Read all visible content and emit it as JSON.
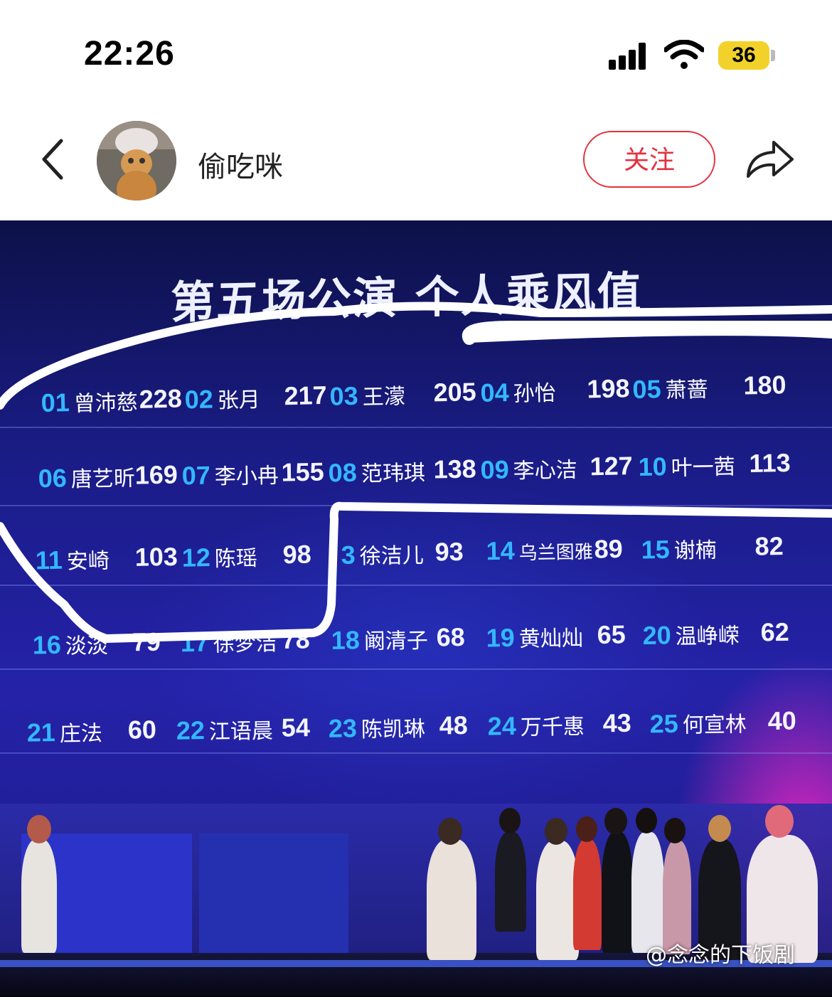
{
  "status_bar": {
    "time": "22:26",
    "battery": "36"
  },
  "header": {
    "username": "偷吃咪",
    "follow_label": "关注"
  },
  "board": {
    "title": "第五场公演 个人乘风值",
    "rows": [
      [
        {
          "num": "01",
          "name": "曾沛慈",
          "value": "228"
        },
        {
          "num": "02",
          "name": "张月",
          "value": "217"
        },
        {
          "num": "03",
          "name": "王濛",
          "value": "205"
        },
        {
          "num": "04",
          "name": "孙怡",
          "value": "198"
        },
        {
          "num": "05",
          "name": "萧蔷",
          "value": "180"
        }
      ],
      [
        {
          "num": "06",
          "name": "唐艺昕",
          "value": "169"
        },
        {
          "num": "07",
          "name": "李小冉",
          "value": "155"
        },
        {
          "num": "08",
          "name": "范玮琪",
          "value": "138"
        },
        {
          "num": "09",
          "name": "李心洁",
          "value": "127"
        },
        {
          "num": "10",
          "name": "叶一茜",
          "value": "113"
        }
      ],
      [
        {
          "num": "11",
          "name": "安崎",
          "value": "103"
        },
        {
          "num": "12",
          "name": "陈瑶",
          "value": "98"
        },
        {
          "num": "3",
          "name": "徐洁儿",
          "value": "93"
        },
        {
          "num": "14",
          "name": "乌兰图雅",
          "value": "89"
        },
        {
          "num": "15",
          "name": "谢楠",
          "value": "82"
        }
      ],
      [
        {
          "num": "16",
          "name": "淡淡",
          "value": "79"
        },
        {
          "num": "17",
          "name": "徐梦洁",
          "value": "78"
        },
        {
          "num": "18",
          "name": "阚清子",
          "value": "68"
        },
        {
          "num": "19",
          "name": "黄灿灿",
          "value": "65"
        },
        {
          "num": "20",
          "name": "温峥嵘",
          "value": "62"
        }
      ],
      [
        {
          "num": "21",
          "name": "庄法",
          "value": "60"
        },
        {
          "num": "22",
          "name": "江语晨",
          "value": "54"
        },
        {
          "num": "23",
          "name": "陈凯琳",
          "value": "48"
        },
        {
          "num": "24",
          "name": "万千惠",
          "value": "43"
        },
        {
          "num": "25",
          "name": "何宣林",
          "value": "40"
        }
      ]
    ]
  },
  "watermark": "@念念的下饭剧"
}
